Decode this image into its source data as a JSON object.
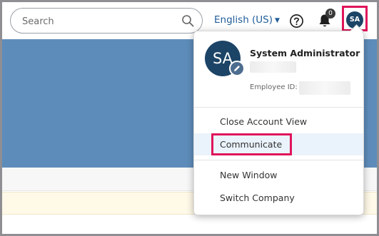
{
  "header": {
    "search": {
      "placeholder": "Search",
      "value": ""
    },
    "language": {
      "label": "English (US)"
    },
    "notifications": {
      "count": "0"
    },
    "user_avatar": {
      "initials": "SA"
    }
  },
  "account_menu": {
    "avatar_initials": "SA",
    "user_name": "System Administrator",
    "employee_id_label": "Employee ID:",
    "items": [
      {
        "label": "Close Account View"
      },
      {
        "label": "Communicate"
      },
      {
        "label": "New Window"
      },
      {
        "label": "Switch Company"
      }
    ]
  },
  "colors": {
    "accent": "#1f5c99",
    "avatar_bg": "#1c4466",
    "banner": "#5e8cba",
    "highlight_border": "#e0145a",
    "selected_item_bg": "#eaf3fb"
  }
}
